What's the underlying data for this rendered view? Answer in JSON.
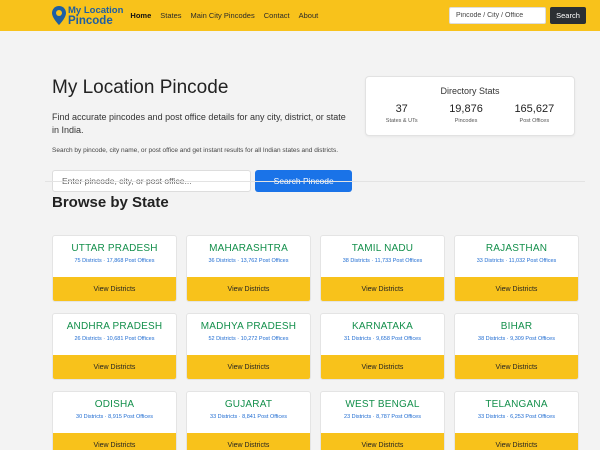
{
  "header": {
    "logo_top": "My Location",
    "logo_bottom": "Pincode",
    "nav": [
      {
        "label": "Home",
        "active": true
      },
      {
        "label": "States"
      },
      {
        "label": "Main City Pincodes"
      },
      {
        "label": "Contact"
      },
      {
        "label": "About"
      }
    ],
    "search_placeholder": "Pincode / City / Office",
    "search_button": "Search"
  },
  "hero": {
    "title": "My Location Pincode",
    "lead": "Find accurate pincodes and post office details for any city, district, or state in India.",
    "sub": "Search by pincode, city name, or post office and get instant results for all Indian states and districts.",
    "search_placeholder": "Enter pincode, city, or post office...",
    "search_button": "Search Pincode"
  },
  "stats": {
    "title": "Directory Stats",
    "items": [
      {
        "value": "37",
        "label": "States & UTs"
      },
      {
        "value": "19,876",
        "label": "Pincodes"
      },
      {
        "value": "165,627",
        "label": "Post Offices"
      }
    ]
  },
  "browse": {
    "title": "Browse by State",
    "button_label": "View Districts",
    "states": [
      {
        "name": "UTTAR PRADESH",
        "meta": "75 Districts · 17,868 Post Offices"
      },
      {
        "name": "MAHARASHTRA",
        "meta": "36 Districts · 13,762 Post Offices"
      },
      {
        "name": "TAMIL NADU",
        "meta": "38 Districts · 11,733 Post Offices"
      },
      {
        "name": "RAJASTHAN",
        "meta": "33 Districts · 11,032 Post Offices"
      },
      {
        "name": "ANDHRA PRADESH",
        "meta": "26 Districts · 10,681 Post Offices"
      },
      {
        "name": "MADHYA PRADESH",
        "meta": "52 Districts · 10,272 Post Offices"
      },
      {
        "name": "KARNATAKA",
        "meta": "31 Districts · 9,658 Post Offices"
      },
      {
        "name": "BIHAR",
        "meta": "38 Districts · 9,309 Post Offices"
      },
      {
        "name": "ODISHA",
        "meta": "30 Districts · 8,915 Post Offices"
      },
      {
        "name": "GUJARAT",
        "meta": "33 Districts · 8,841 Post Offices"
      },
      {
        "name": "WEST BENGAL",
        "meta": "23 Districts · 8,787 Post Offices"
      },
      {
        "name": "TELANGANA",
        "meta": "33 Districts · 6,253 Post Offices"
      }
    ]
  },
  "colors": {
    "brand_yellow": "#f8c21b",
    "link_blue": "#1a73e8",
    "state_green": "#138f4b"
  }
}
